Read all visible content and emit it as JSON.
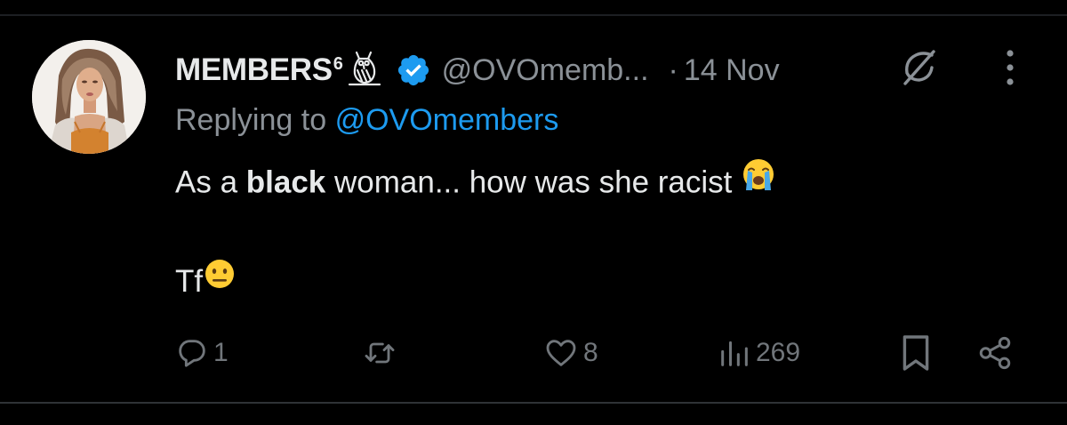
{
  "tweet": {
    "author": {
      "display_name": "MEMBERS",
      "name_superscript": "6",
      "handle": "@OVOmemb...",
      "verified": true
    },
    "separator": "·",
    "date": "14 Nov",
    "replying_prefix": "Replying to",
    "replying_handle": "@OVOmembers",
    "body": {
      "prefix": "As a ",
      "bold": "black",
      "suffix": " woman... how was she racist",
      "emoji1": "loudly-crying-face",
      "line2_text": "Tf",
      "emoji2": "neutral-face"
    },
    "actions": {
      "replies": "1",
      "retweets": "",
      "likes": "8",
      "views": "269"
    }
  },
  "icons": {
    "verified": "verified-badge-icon",
    "owl": "owl-icon",
    "grok": "grok-icon",
    "more": "more-options-icon",
    "reply": "reply-icon",
    "retweet": "retweet-icon",
    "like": "like-icon",
    "views": "views-icon",
    "bookmark": "bookmark-icon",
    "share": "share-icon"
  },
  "colors": {
    "background": "#000000",
    "text_primary": "#e7e9ea",
    "text_secondary": "#8b9197",
    "link": "#1d9bf0",
    "verified_badge": "#1d9bf0",
    "icon": "#71767b"
  }
}
